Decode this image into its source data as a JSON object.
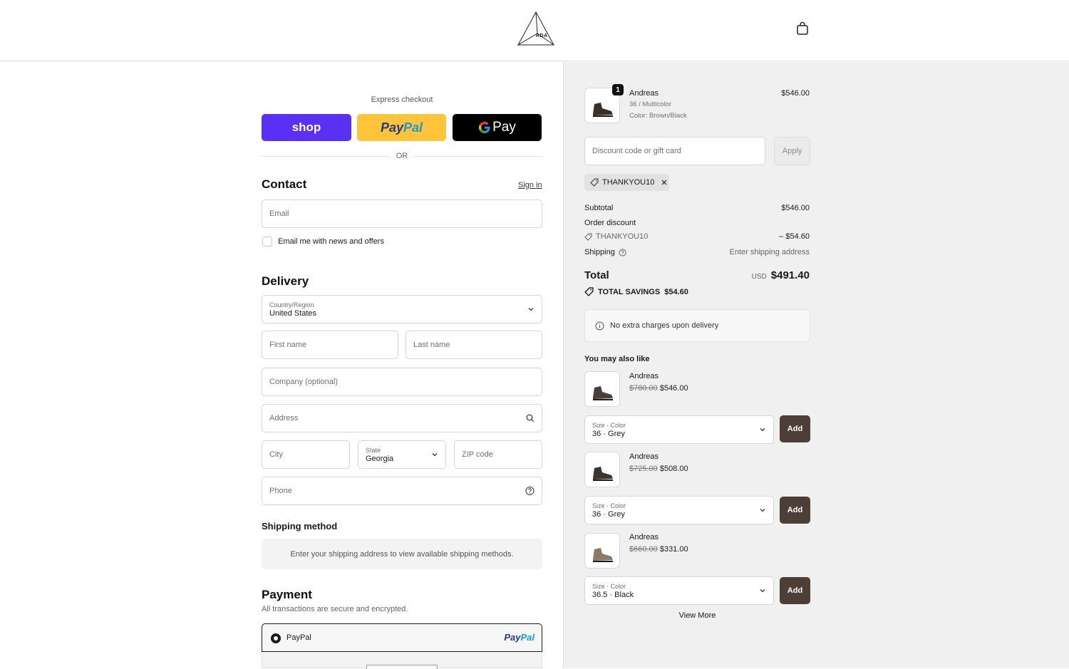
{
  "header": {
    "logo_text": "RDA"
  },
  "express": {
    "label": "Express checkout",
    "shop_label": "shop",
    "paypal_pay": "Pay",
    "paypal_pal": "Pal",
    "gpay_label": "Pay",
    "or_label": "OR"
  },
  "contact": {
    "title": "Contact",
    "sign_in": "Sign in",
    "email_placeholder": "Email",
    "newsletter_label": "Email me with news and offers"
  },
  "delivery": {
    "title": "Delivery",
    "country_label": "Country/Region",
    "country_value": "United States",
    "first_name": "First name",
    "last_name": "Last name",
    "company": "Company (optional)",
    "address": "Address",
    "city": "City",
    "state_label": "State",
    "state_value": "Georgia",
    "zip": "ZIP code",
    "phone": "Phone"
  },
  "shipping_method": {
    "title": "Shipping method",
    "message": "Enter your shipping address to view available shipping methods."
  },
  "payment": {
    "title": "Payment",
    "subtitle": "All transactions are secure and encrypted.",
    "option_label": "PayPal",
    "option_logo_pay": "Pay",
    "option_logo_pal": "Pal"
  },
  "summary": {
    "item": {
      "qty": "1",
      "name": "Andreas",
      "variant": "36 / Multicolor",
      "color": "Color: Brown/Black",
      "price": "$546.00"
    },
    "discount_placeholder": "Discount code or gift card",
    "apply_label": "Apply",
    "applied_code": "THANKYOU10",
    "subtotal_label": "Subtotal",
    "subtotal_value": "$546.00",
    "order_discount_label": "Order discount",
    "discount_code": "THANKYOU10",
    "discount_value": "– $54.60",
    "shipping_label": "Shipping",
    "shipping_value": "Enter shipping address",
    "total_label": "Total",
    "total_currency": "USD",
    "total_value": "$491.40",
    "savings_label": "TOTAL SAVINGS",
    "savings_value": "$54.60",
    "info_message": "No extra charges upon delivery"
  },
  "upsell": {
    "title": "You may also like",
    "items": [
      {
        "name": "Andreas",
        "old_price": "$780.00",
        "price": "$546.00",
        "select_label": "Size · Color",
        "select_value": "36 · Grey",
        "add_label": "Add"
      },
      {
        "name": "Andreas",
        "old_price": "$725.00",
        "price": "$508.00",
        "select_label": "Size · Color",
        "select_value": "36 · Grey",
        "add_label": "Add"
      },
      {
        "name": "Andreas",
        "old_price": "$660.00",
        "price": "$331.00",
        "select_label": "Size · Color",
        "select_value": "36.5 · Black",
        "add_label": "Add"
      }
    ],
    "view_more": "View More"
  },
  "colors": {
    "shop_purple": "#5a31f4",
    "paypal_yellow": "#ffc439",
    "add_button": "#4d3f37"
  }
}
